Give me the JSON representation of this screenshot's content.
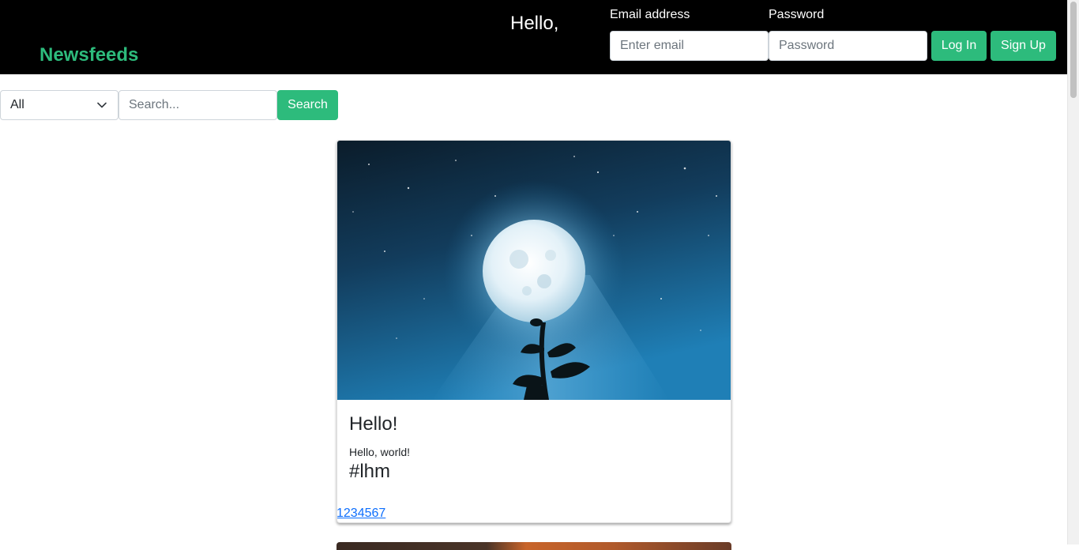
{
  "navbar": {
    "brand": "Newsfeeds",
    "greeting": "Hello,",
    "email_label": "Email address",
    "email_placeholder": "Enter email",
    "password_label": "Password",
    "password_placeholder": "Password",
    "login_label": "Log In",
    "signup_label": "Sign Up"
  },
  "filters": {
    "category_selected": "All",
    "search_placeholder": "Search...",
    "search_button": "Search"
  },
  "posts": [
    {
      "title": "Hello!",
      "body": "Hello, world!",
      "tag": "#lhm",
      "link_text": "1234567"
    }
  ],
  "colors": {
    "accent": "#2dbb7c",
    "navbar_bg": "#000000",
    "link": "#0d6efd"
  },
  "icons": [
    "chevron-down-icon"
  ]
}
